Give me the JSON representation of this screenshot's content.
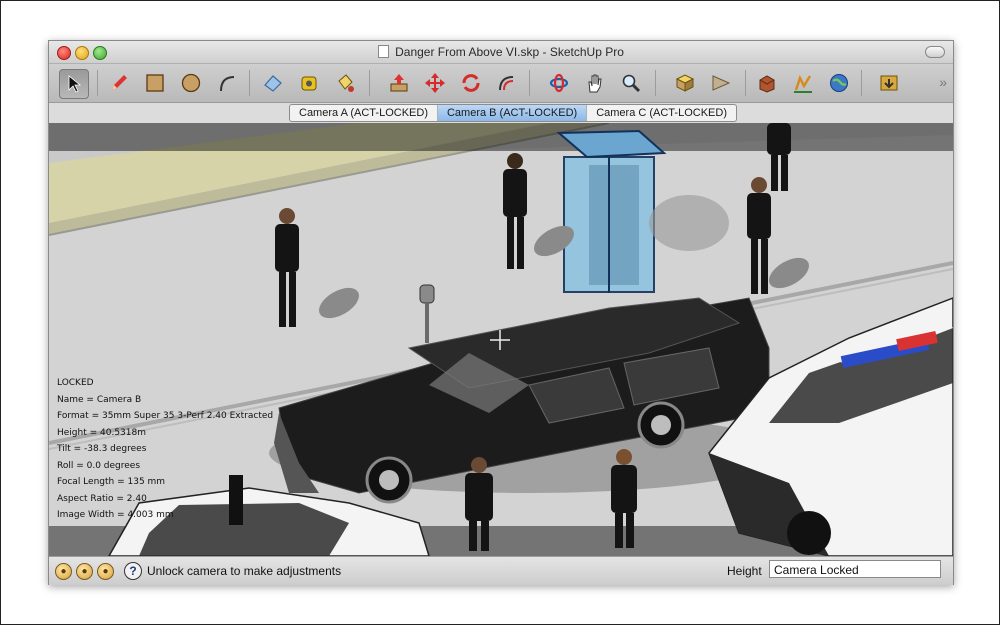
{
  "window": {
    "title": "Danger From Above VI.skp - SketchUp Pro"
  },
  "toolbar": {
    "tools": [
      {
        "name": "select-icon"
      },
      {
        "name": "pencil-icon"
      },
      {
        "name": "rectangle-icon"
      },
      {
        "name": "circle-icon"
      },
      {
        "name": "arc-icon"
      },
      {
        "name": "eraser-icon"
      },
      {
        "name": "tape-measure-icon"
      },
      {
        "name": "paint-bucket-icon"
      },
      {
        "name": "push-pull-icon"
      },
      {
        "name": "move-icon"
      },
      {
        "name": "rotate-icon"
      },
      {
        "name": "offset-icon"
      },
      {
        "name": "orbit-icon"
      },
      {
        "name": "pan-icon"
      },
      {
        "name": "zoom-icon"
      },
      {
        "name": "zoom-extents-icon"
      },
      {
        "name": "previous-view-icon"
      },
      {
        "name": "component-warehouse-icon"
      },
      {
        "name": "add-location-icon"
      },
      {
        "name": "google-earth-icon"
      },
      {
        "name": "extension-warehouse-icon"
      }
    ],
    "more_label": "»"
  },
  "scenes": {
    "tabs": [
      "Camera A (ACT-LOCKED)",
      "Camera B (ACT-LOCKED)",
      "Camera C (ACT-LOCKED)"
    ],
    "active_index": 1
  },
  "camera_info": {
    "status": "LOCKED",
    "name": "Name = Camera B",
    "format": "Format = 35mm Super 35 3-Perf 2.40 Extracted",
    "height": "Height = 40.5318m",
    "tilt": "Tilt = -38.3 degrees",
    "roll": "Roll = 0.0 degrees",
    "focal_length": "Focal Length = 135 mm",
    "aspect_ratio": "Aspect Ratio = 2.40",
    "image_width": "Image Width = 4.003 mm"
  },
  "statusbar": {
    "message": "Unlock camera to make adjustments",
    "help_label": "?",
    "vcb_label": "Height",
    "vcb_value": "Camera Locked"
  }
}
